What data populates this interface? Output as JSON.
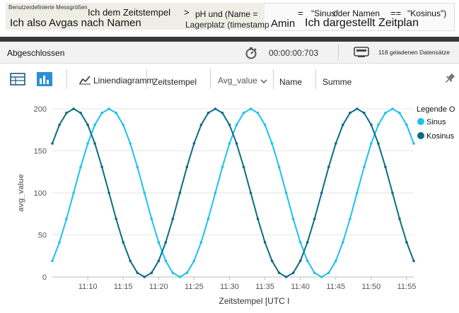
{
  "query": {
    "line1_small": "Benutzerdefinierte Messgrößen",
    "line1_a": "Ich dem Zeitstempel",
    "line1_gt": ">",
    "line1_b": "pH und (Name =",
    "line1_eq": "=",
    "line1_c": "\"Sinus\"",
    "line1_d": "oder Namen",
    "line1_e": "==",
    "line1_f": "\"Kosinus\")",
    "line2_a": "Ich also Avgas nach Namen",
    "line2_b": "Lagerplatz (timestamp",
    "line2_c": "Amin",
    "line2_d": "Ich dargestellt Zeitplan"
  },
  "status": {
    "tab_label": "Abgeschlossen",
    "elapsed": "00:00:00:703",
    "records": "118 geladenen Datensätze"
  },
  "toolbar": {
    "line_chart_label": "Liniendiagramm",
    "x_field": "Zeitstempel",
    "y_field": "Avg_value",
    "split_field": "Name",
    "agg_label": "Summe"
  },
  "chart_data": {
    "type": "line",
    "xlabel": "Zeitstempel [UTC I",
    "ylabel": "avg_value",
    "ylim": [
      0,
      200
    ],
    "yticks": [
      0,
      50,
      100,
      150,
      200
    ],
    "x_range_minutes": [
      "11:05",
      "11:56"
    ],
    "xticks": [
      "11:10",
      "11:15",
      "11:20",
      "11:25",
      "11:30",
      "11:35",
      "11:40",
      "11:45",
      "11:50",
      "11:55"
    ],
    "legend_title": "Legende O",
    "legend_position": "top-right",
    "grid": "horizontal",
    "series": [
      {
        "name": "Sinus",
        "color": "#1ec0f0",
        "period_minutes": 20,
        "peak_time": "11:13",
        "amplitude": 100,
        "offset": 100
      },
      {
        "name": "Kosinus",
        "color": "#0a6c84",
        "period_minutes": 20,
        "peak_time": "11:08",
        "amplitude": 100,
        "offset": 100
      }
    ]
  },
  "icons": {
    "timer": "stopwatch-icon",
    "records": "database-icon",
    "table": "table-icon",
    "bar": "bar-chart-icon",
    "line": "line-chart-icon",
    "pin": "pin-icon",
    "dropdown": "chevron-down-icon"
  }
}
